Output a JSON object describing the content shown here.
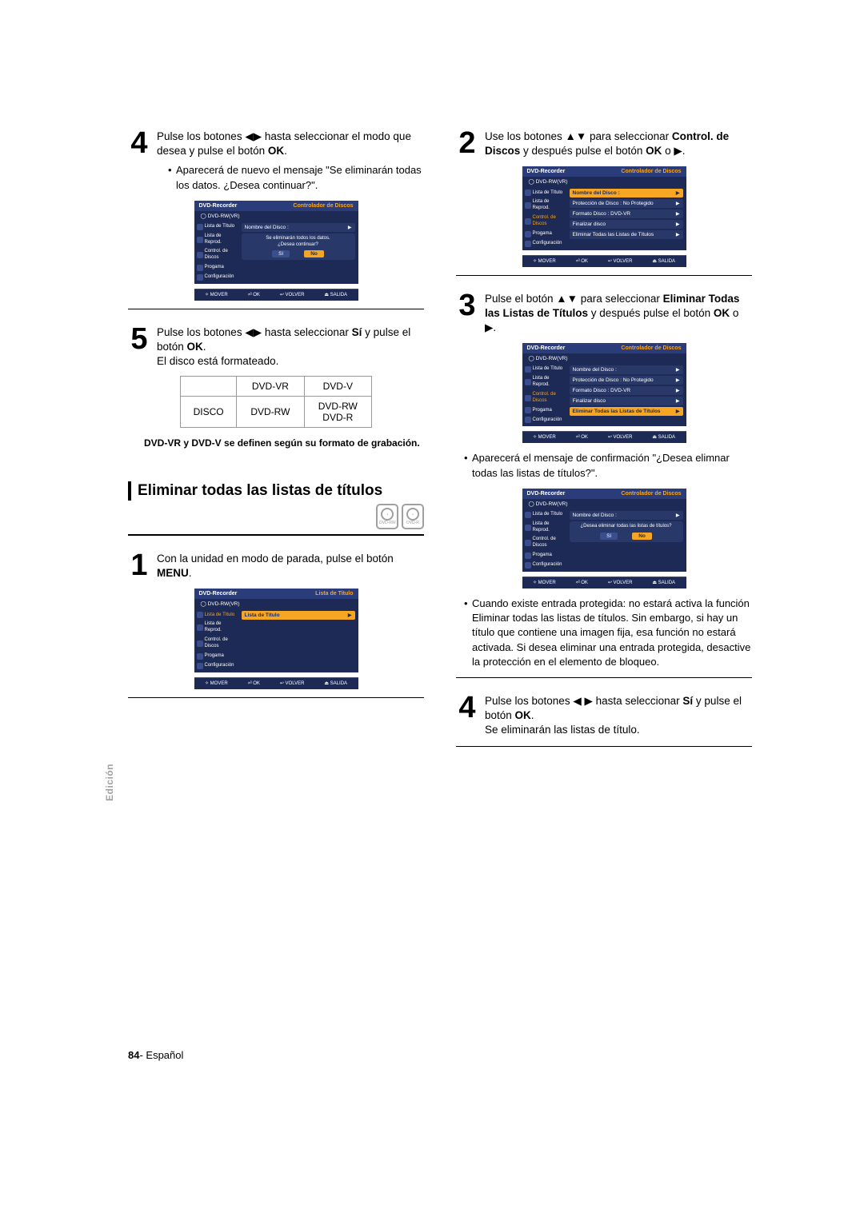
{
  "side_tab": "Edición",
  "page_num": "84",
  "page_lang": "- Español",
  "osd_common": {
    "title_left": "DVD-Recorder",
    "title_right_ctrl": "Controlador de Discos",
    "title_right_list": "Lista de Titulo",
    "subheader": "◯ DVD-RW(VR)",
    "footer": {
      "mover": "✧ MOVER",
      "ok": "⏎ OK",
      "volver": "↩ VOLVER",
      "salida": "⏏ SALIDA"
    },
    "sidebar_items": [
      "Lista de Título",
      "Lista de Reprod.",
      "Control. de Discos",
      "Progama",
      "Configuración"
    ],
    "si": "Sí",
    "no": "No"
  },
  "left": {
    "step4": {
      "text_a": "Pulse los botones ◀▶ hasta seleccionar el modo que desea y pulse el botón ",
      "text_b": "OK",
      "text_c": ".",
      "bullet": "Aparecerá de nuevo el mensaje \"Se eliminarán todas los datos. ¿Desea continuar?\"."
    },
    "osd4": {
      "row1": "Nombre del Disco :",
      "dialog_line1": "Se eliminarán todos los datos.",
      "dialog_line2": "¿Desea continuar?"
    },
    "step5": {
      "text_a": "Pulse los botones ◀▶ hasta seleccionar ",
      "text_b": "Sí",
      "text_c": " y pulse el botón ",
      "text_d": "OK",
      "text_e": ".",
      "line2": "El disco está formateado."
    },
    "table": {
      "h1": "DVD-VR",
      "h2": "DVD-V",
      "r1": "DISCO",
      "c1": "DVD-RW",
      "c2a": "DVD-RW",
      "c2b": "DVD-R"
    },
    "table_note": "DVD-VR y DVD-V se definen según su formato de grabación.",
    "section_heading": "Eliminar todas las listas de títulos",
    "disc1": "DVD-RW",
    "disc2": "DVD-R",
    "step1": {
      "text_a": "Con la unidad en modo de parada, pulse el botón ",
      "text_b": "MENU",
      "text_c": "."
    },
    "osd1": {
      "row1": "Lista de Título"
    }
  },
  "right": {
    "step2": {
      "text_a": "Use los botones ▲▼ para seleccionar ",
      "text_b": "Control. de Discos",
      "text_c": " y después pulse el botón ",
      "text_d": "OK",
      "text_e": " o ▶."
    },
    "osd2_rows": [
      {
        "label": "Nombre del Disco :",
        "value": "",
        "hl": true
      },
      {
        "label": "Protección de Disco : No Protegido",
        "value": "",
        "hl": false
      },
      {
        "label": "Formato Disco",
        "value": ": DVD-VR",
        "hl": false
      },
      {
        "label": "Finalizar disco",
        "value": "",
        "hl": false
      },
      {
        "label": "Eliminar Todas las Listas de Títulos",
        "value": "",
        "hl": false
      }
    ],
    "step3": {
      "text_a": "Pulse el botón ▲▼ para seleccionar ",
      "text_b": "Eliminar Todas las Listas de Títulos",
      "text_c": " y después pulse el botón ",
      "text_d": "OK",
      "text_e": " o ▶."
    },
    "osd3_rows": [
      {
        "label": "Nombre del Disco :",
        "value": "",
        "hl": false
      },
      {
        "label": "Protección de Disco : No Protegido",
        "value": "",
        "hl": false
      },
      {
        "label": "Formato Disco",
        "value": ": DVD-VR",
        "hl": false
      },
      {
        "label": "Finalizar disco",
        "value": "",
        "hl": false
      },
      {
        "label": "Eliminar Todas las Listas de Títulos",
        "value": "",
        "hl": true
      }
    ],
    "step3_bullet": "Aparecerá el mensaje de confirmación \"¿Desea elimnar todas las listas de títulos?\".",
    "osd_confirm": {
      "row1": "Nombre del Disco :",
      "dialog_line": "¿Desea eliminar todas las listas de títulos?",
      "no_hl": "No"
    },
    "step3_bullet2": "Cuando existe entrada protegida: no estará activa la función Eliminar todas las listas de títulos. Sin embargo, si hay un título que contiene una imagen fija, esa función no estará activada. Si desea eliminar una entrada protegida, desactive la protección en el elemento de bloqueo.",
    "step4": {
      "text_a": "Pulse los botones ◀ ▶ hasta seleccionar ",
      "text_b": "Sí",
      "text_c": " y pulse el botón ",
      "text_d": "OK",
      "text_e": ".",
      "line2": "Se eliminarán las listas de título."
    }
  }
}
